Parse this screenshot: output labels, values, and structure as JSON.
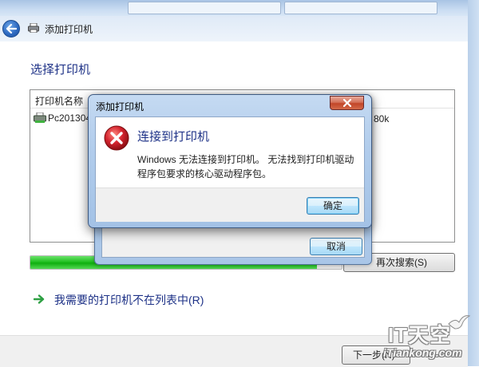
{
  "window": {
    "title": "添加打印机"
  },
  "wizard": {
    "section_title": "选择打印机",
    "column_name": "打印机名称",
    "printer_row_name": "Pc201304",
    "printer_row_extra": "80k",
    "progress_fraction": 0.92,
    "search_again_label": "再次搜索(S)",
    "not_listed_label": "我需要的打印机不在列表中(R)",
    "next_label": "下一步(N)"
  },
  "back_dialog": {
    "cancel_label": "取消"
  },
  "error_dialog": {
    "title": "添加打印机",
    "heading": "连接到打印机",
    "message": "Windows 无法连接到打印机。 无法找到打印机驱动程序包要求的核心驱动程序包。",
    "ok_label": "确定"
  },
  "watermark": {
    "brand": "IT天空",
    "site": "iTiankong.com"
  },
  "colors": {
    "heading_blue": "#1e3287",
    "progress_green": "#22c022",
    "error_red": "#d3232e"
  },
  "icons": [
    "back-arrow-icon",
    "printer-icon",
    "error-icon",
    "close-icon",
    "green-arrow-icon",
    "bird-logo-icon"
  ]
}
